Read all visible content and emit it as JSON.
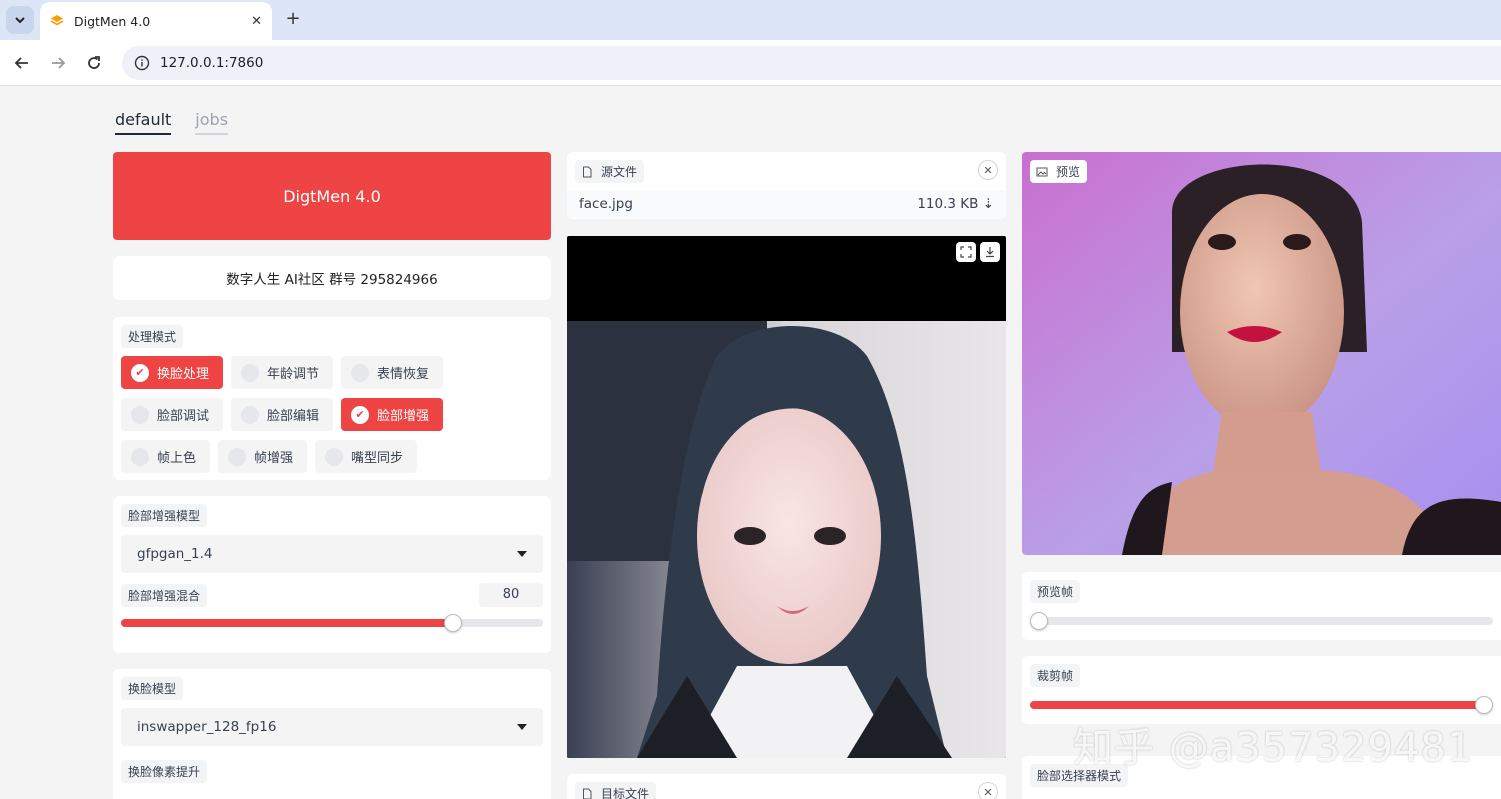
{
  "browser": {
    "tab_title": "DigtMen 4.0",
    "url": "127.0.0.1:7860"
  },
  "page_tabs": [
    {
      "label": "default",
      "active": true
    },
    {
      "label": "jobs",
      "active": false
    }
  ],
  "header": {
    "title": "DigtMen 4.0",
    "subtitle": "数字人生 AI社区 群号 295824966",
    "accent_color": "#ef4444"
  },
  "processing_mode": {
    "label": "处理模式",
    "options": [
      {
        "label": "换脸处理",
        "checked": true
      },
      {
        "label": "年龄调节",
        "checked": false
      },
      {
        "label": "表情恢复",
        "checked": false
      },
      {
        "label": "脸部调试",
        "checked": false
      },
      {
        "label": "脸部编辑",
        "checked": false
      },
      {
        "label": "脸部增强",
        "checked": true
      },
      {
        "label": "帧上色",
        "checked": false
      },
      {
        "label": "帧增强",
        "checked": false
      },
      {
        "label": "嘴型同步",
        "checked": false
      }
    ]
  },
  "face_enhancer": {
    "model_label": "脸部增强模型",
    "model_value": "gfpgan_1.4",
    "blend_label": "脸部增强混合",
    "blend_value": "80",
    "blend_fraction": 0.8
  },
  "face_swapper": {
    "model_label": "换脸模型",
    "model_value": "inswapper_128_fp16",
    "pixel_boost_label": "换脸像素提升"
  },
  "source_file": {
    "label": "源文件",
    "name": "face.jpg",
    "size": "110.3 KB"
  },
  "target_file": {
    "label": "目标文件"
  },
  "preview": {
    "label": "预览",
    "frame_label": "预览帧",
    "frame_fraction": 0.0,
    "trim_label": "裁剪帧",
    "trim_fraction": 1.0,
    "selector_label": "脸部选择器模式"
  },
  "watermark": "知乎 @a357329481",
  "icons": {
    "tab_menu": "chevron-down-icon",
    "close": "close-icon",
    "new_tab": "plus-icon",
    "back": "arrow-left-icon",
    "forward": "arrow-right-icon",
    "reload": "reload-icon",
    "site_info": "info-icon",
    "file": "file-icon",
    "fullscreen": "fullscreen-icon",
    "download": "download-icon",
    "image": "image-icon"
  }
}
